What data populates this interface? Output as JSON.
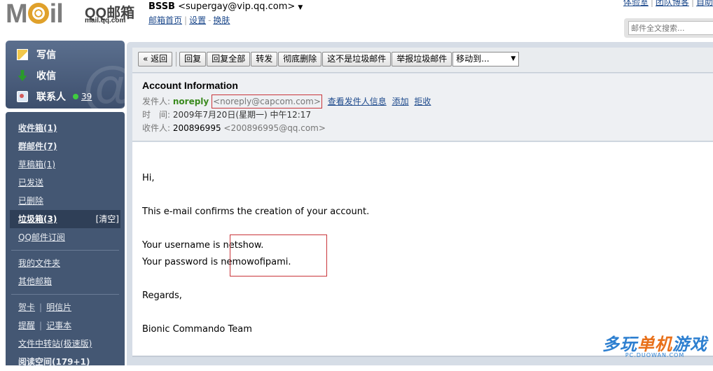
{
  "header": {
    "logo_mail": "Mail",
    "logo_qq": "QQ邮箱",
    "logo_domain": "mail.qq.com",
    "account_name": "BSSB",
    "account_email": "<supergay@vip.qq.com>",
    "links": [
      "邮箱首页",
      "设置",
      "换肤"
    ],
    "top_right_links": [
      "体验室",
      "团队博客",
      "自助"
    ],
    "search_placeholder": "邮件全文搜索..."
  },
  "sidebar": {
    "quick_actions": {
      "compose": "写信",
      "receive": "收信",
      "contacts": "联系人",
      "contacts_count": "39"
    },
    "folders": [
      {
        "label": "收件箱(1)",
        "bold": true
      },
      {
        "label": "群邮件(7)",
        "bold": true
      },
      {
        "label": "草稿箱(1)",
        "bold": false
      },
      {
        "label": "已发送",
        "bold": false
      },
      {
        "label": "已删除",
        "bold": false
      },
      {
        "label": "垃圾箱(3)",
        "bold": true,
        "active": true,
        "action": "[清空]"
      },
      {
        "label": "QQ邮件订阅",
        "bold": false
      }
    ],
    "extra_folders": [
      "我的文件夹",
      "其他邮箱"
    ],
    "tools_row1": [
      "贺卡",
      "明信片"
    ],
    "tools_row2": [
      "提醒",
      "记事本"
    ],
    "tools_row3": "文件中转站(极速版)",
    "reading": "阅读空间(179+1)"
  },
  "toolbar": {
    "back": "« 返回",
    "reply": "回复",
    "reply_all": "回复全部",
    "forward": "转发",
    "delete": "彻底删除",
    "not_spam": "这不是垃圾邮件",
    "report_spam": "举报垃圾邮件",
    "move_to": "移动到..."
  },
  "message": {
    "subject": "Account Information",
    "from_label": "发件人:",
    "from_name": "noreply",
    "from_addr": "<noreply@capcom.com>",
    "from_links": [
      "查看发件人信息",
      "添加",
      "拒收"
    ],
    "time_label": "时　间:",
    "time": "2009年7月20日(星期一) 中午12:17",
    "to_label": "收件人:",
    "to_name": "200896995",
    "to_addr": "<200896995@qq.com>",
    "body": {
      "greeting": "Hi,",
      "line1": "This e-mail confirms the creation of your account.",
      "username_label": "Your username is ",
      "username": "netshow.",
      "password_label": "Your password is ",
      "password": "nemowofipami.",
      "regards": "Regards,",
      "signature": "Bionic Commando Team"
    }
  },
  "watermark": {
    "text_a": "多玩",
    "text_b": "单机",
    "text_c": "游戏",
    "url": "PC.DUOWAN.COM"
  },
  "colors": {
    "sidebar_bg": "#445773",
    "sender_green": "#3a8a1e",
    "highlight_red": "#c9353a",
    "link_blue": "#1e4a8c"
  }
}
